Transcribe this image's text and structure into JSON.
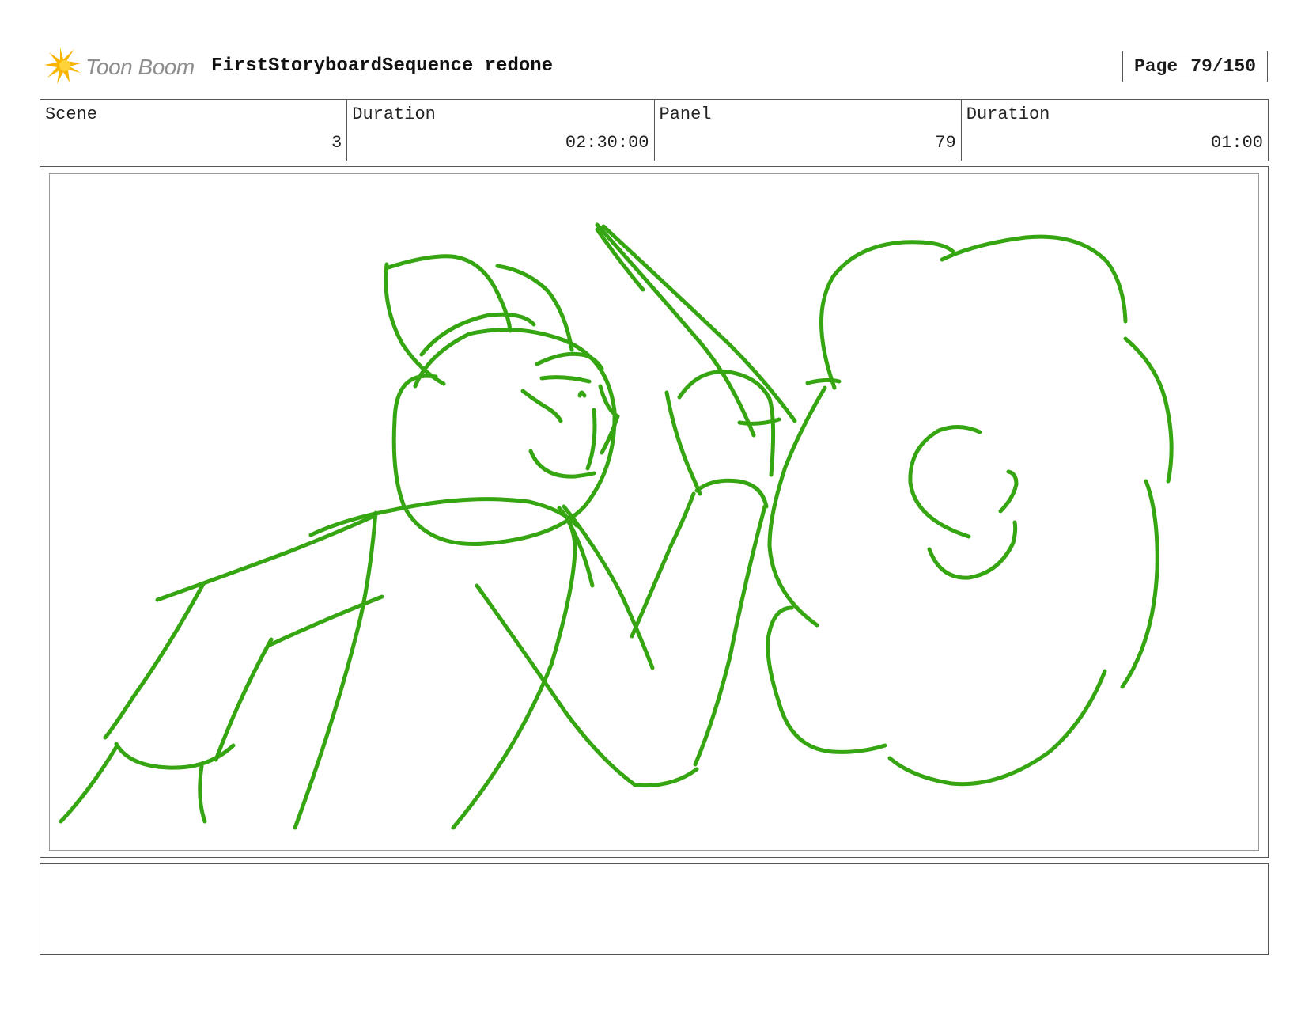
{
  "header": {
    "logo_text": "Toon Boom",
    "title": "FirstStoryboardSequence redone",
    "page_label": "Page",
    "page_value": "79/150"
  },
  "info": {
    "scene_label": "Scene",
    "scene_value": "3",
    "scene_duration_label": "Duration",
    "scene_duration_value": "02:30:00",
    "panel_label": "Panel",
    "panel_value": "79",
    "panel_duration_label": "Duration",
    "panel_duration_value": "01:00"
  },
  "panel": {
    "sketch_color": "#36a512"
  },
  "notes": {
    "text": ""
  }
}
